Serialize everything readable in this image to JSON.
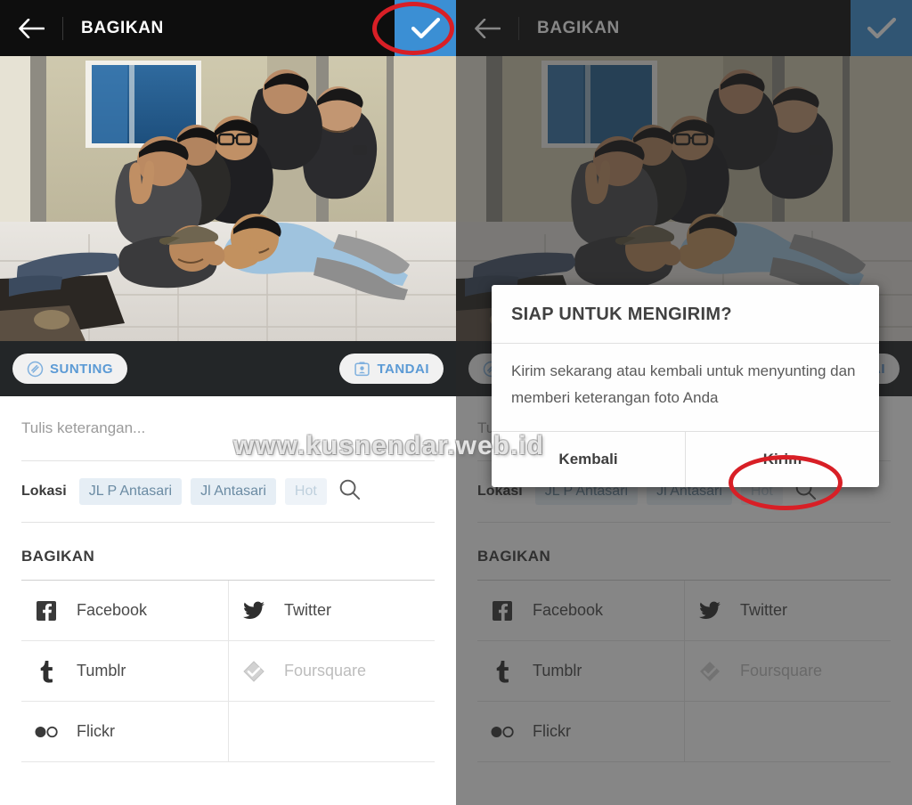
{
  "app": {
    "appbar": {
      "back_icon": "back-arrow-icon",
      "title": "BAGIKAN",
      "confirm_icon": "checkmark-icon",
      "confirm_bg": "#3b8fd4",
      "bar_bg": "#0e0e0e"
    },
    "photo": {
      "alt": "group-photo-six-men-posing-on-floor"
    },
    "photo_actions": {
      "edit": {
        "icon": "adjust-circle-icon",
        "label": "SUNTING"
      },
      "tag": {
        "icon": "person-tag-icon",
        "label": "TANDAI"
      },
      "accent": "#5b9ad5"
    },
    "caption": {
      "placeholder": "Tulis keterangan...",
      "value": ""
    },
    "location": {
      "label": "Lokasi",
      "chips": [
        {
          "text": "JL P Antasari",
          "faded": false
        },
        {
          "text": "Jl Antasari",
          "faded": false
        },
        {
          "text": "Hot",
          "faded": true
        }
      ],
      "search_icon": "search-icon"
    },
    "share": {
      "heading": "BAGIKAN",
      "items": [
        {
          "label": "Facebook",
          "icon": "facebook-icon",
          "disabled": false
        },
        {
          "label": "Twitter",
          "icon": "twitter-icon",
          "disabled": false
        },
        {
          "label": "Tumblr",
          "icon": "tumblr-icon",
          "disabled": false
        },
        {
          "label": "Foursquare",
          "icon": "foursquare-icon",
          "disabled": true
        },
        {
          "label": "Flickr",
          "icon": "flickr-icon",
          "disabled": false
        }
      ]
    }
  },
  "dialog": {
    "title": "SIAP UNTUK MENGIRIM?",
    "body": "Kirim sekarang atau kembali untuk menyunting dan memberi keterangan foto Anda",
    "cancel_label": "Kembali",
    "confirm_label": "Kirim"
  },
  "annotations": {
    "color": "#d81f26",
    "circle_confirm": "highlight-confirm-checkmark",
    "circle_kirim": "highlight-kirim-button"
  },
  "watermark": {
    "text": "www.kusnendar.web.id"
  }
}
